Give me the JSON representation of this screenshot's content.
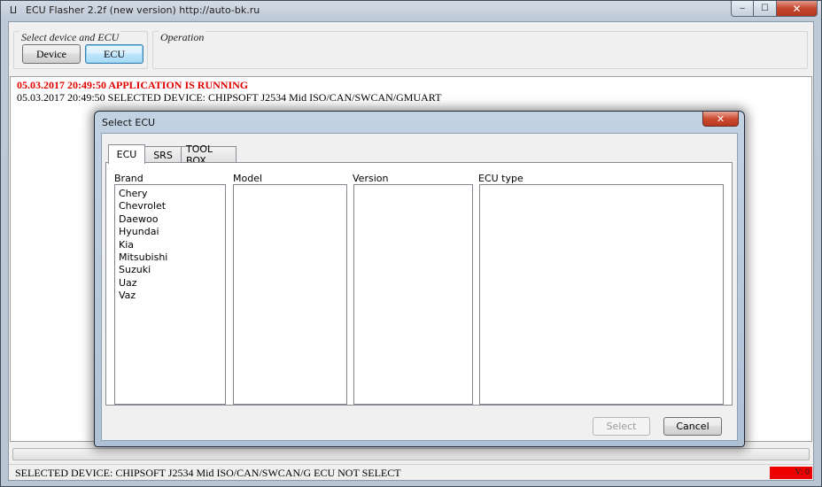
{
  "window": {
    "title": "ECU Flasher 2.2f (new version) http://auto-bk.ru",
    "icon": "app-icon",
    "controls": {
      "minimize": "‒",
      "maximize": "☐",
      "close": "✕"
    }
  },
  "toolbar": {
    "device_group_label": "Select device and ECU",
    "operation_group_label": "Operation",
    "device_button": "Device",
    "ecu_button": "ECU"
  },
  "log": [
    {
      "text": "05.03.2017 20:49:50 APPLICATION IS RUNNING",
      "color": "#e00000"
    },
    {
      "text": "05.03.2017 20:49:50 SELECTED DEVICE: CHIPSOFT J2534 Mid ISO/CAN/SWCAN/GMUART",
      "color": "#000000"
    }
  ],
  "status_bar": {
    "text": "SELECTED DEVICE: CHIPSOFT J2534 Mid ISO/CAN/SWCAN/G  ECU NOT SELECT",
    "version": "V: 0",
    "version_color": "#ee0000"
  },
  "dialog": {
    "title": "Select ECU",
    "close": "✕",
    "tabs": [
      {
        "label": "ECU",
        "active": true
      },
      {
        "label": "SRS",
        "active": false
      },
      {
        "label": "TOOL BOX",
        "active": false
      }
    ],
    "columns": {
      "brand": "Brand",
      "model": "Model",
      "version": "Version",
      "ecu_type": "ECU type"
    },
    "brands": [
      "Chery",
      "Chevrolet",
      "Daewoo",
      "Hyundai",
      "Kia",
      "Mitsubishi",
      "Suzuki",
      "Uaz",
      "Vaz"
    ],
    "buttons": {
      "select": "Select",
      "cancel": "Cancel"
    }
  }
}
